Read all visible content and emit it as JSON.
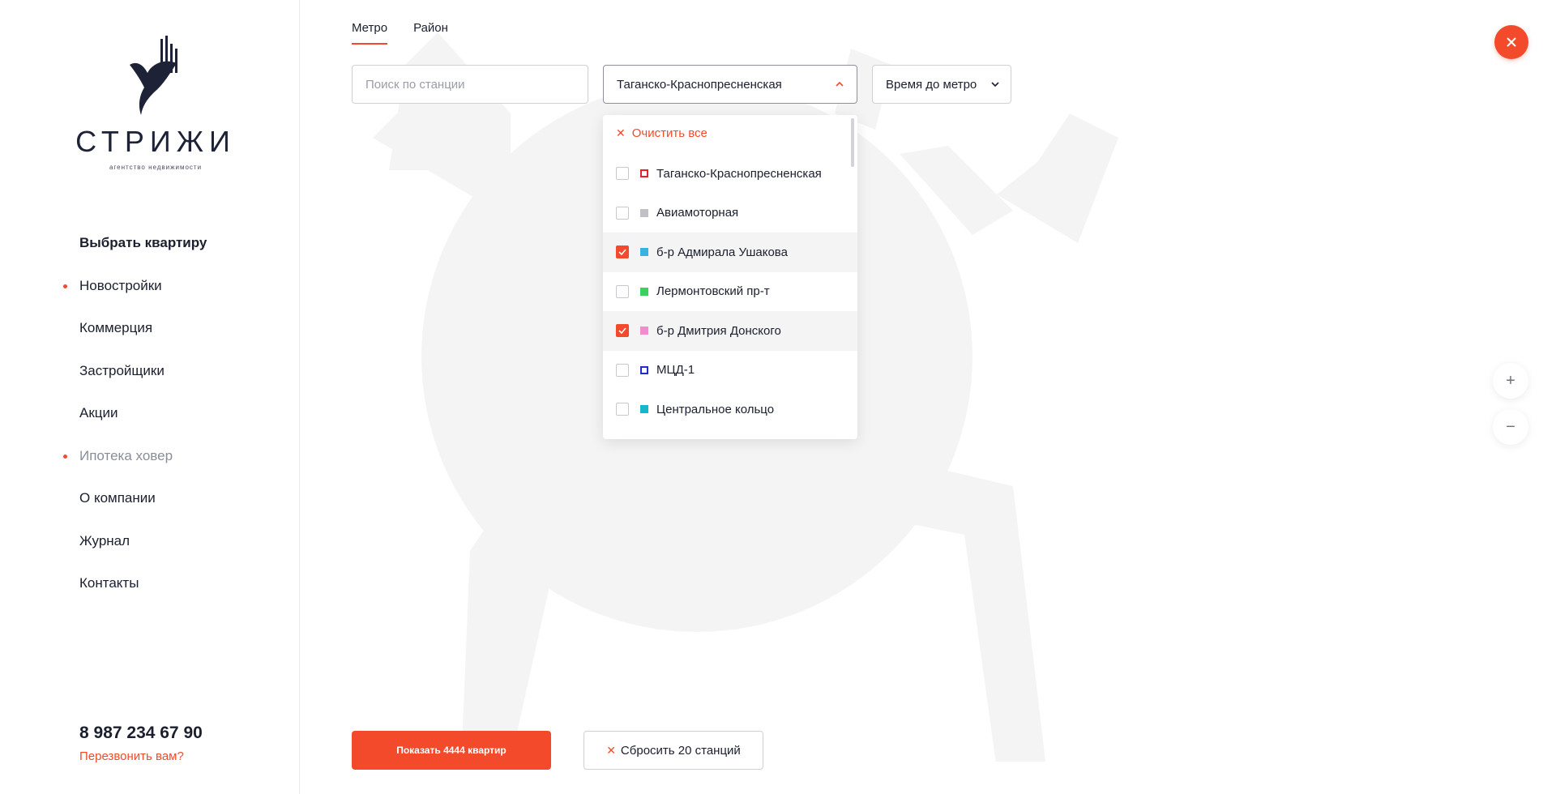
{
  "brand": {
    "name": "СТРИЖИ",
    "tagline": "агентство недвижимости"
  },
  "nav": {
    "items": [
      {
        "label": "Выбрать квартиру",
        "bold": true,
        "dot": false,
        "muted": false
      },
      {
        "label": "Новостройки",
        "bold": false,
        "dot": true,
        "muted": false
      },
      {
        "label": "Коммерция",
        "bold": false,
        "dot": false,
        "muted": false
      },
      {
        "label": "Застройщики",
        "bold": false,
        "dot": false,
        "muted": false
      },
      {
        "label": "Акции",
        "bold": false,
        "dot": false,
        "muted": false
      },
      {
        "label": "Ипотека ховер",
        "bold": false,
        "dot": true,
        "muted": true
      },
      {
        "label": "О компании",
        "bold": false,
        "dot": false,
        "muted": false
      },
      {
        "label": "Журнал",
        "bold": false,
        "dot": false,
        "muted": false
      },
      {
        "label": "Контакты",
        "bold": false,
        "dot": false,
        "muted": false
      }
    ]
  },
  "contact": {
    "phone": "8 987 234 67 90",
    "callback": "Перезвонить вам?"
  },
  "tabs": [
    {
      "label": "Метро",
      "active": true
    },
    {
      "label": "Район",
      "active": false
    }
  ],
  "search": {
    "placeholder": "Поиск по станции",
    "value": ""
  },
  "station_select": {
    "value": "Таганско-Краснопресненская"
  },
  "time_select": {
    "value": "Время до метро"
  },
  "dropdown": {
    "clear_all": "Очистить все",
    "options": [
      {
        "label": "Таганско-Краснопресненская",
        "checked": false,
        "color": "#e4222a",
        "outline": true
      },
      {
        "label": "Авиамоторная",
        "checked": false,
        "color": "#c0c1c4",
        "outline": false
      },
      {
        "label": "б-р Адмирала Ушакова",
        "checked": true,
        "color": "#36b3e2",
        "outline": false
      },
      {
        "label": "Лермонтовский пр-т",
        "checked": false,
        "color": "#3bd160",
        "outline": false
      },
      {
        "label": "б-р Дмитрия Донского",
        "checked": true,
        "color": "#f28bd0",
        "outline": false
      },
      {
        "label": "МЦД-1",
        "checked": false,
        "color": "#1d2fc9",
        "outline": true
      },
      {
        "label": "Центральное кольцо",
        "checked": false,
        "color": "#13b8cc",
        "outline": false
      }
    ]
  },
  "actions": {
    "show_label": "Показать 4444 квартир",
    "reset_label": "Сбросить 20 станций"
  },
  "colors": {
    "accent": "#f24a2a",
    "text": "#1b1f2e",
    "map_shape": "#f4f4f4"
  },
  "zoom": {
    "in": "+",
    "out": "−"
  }
}
